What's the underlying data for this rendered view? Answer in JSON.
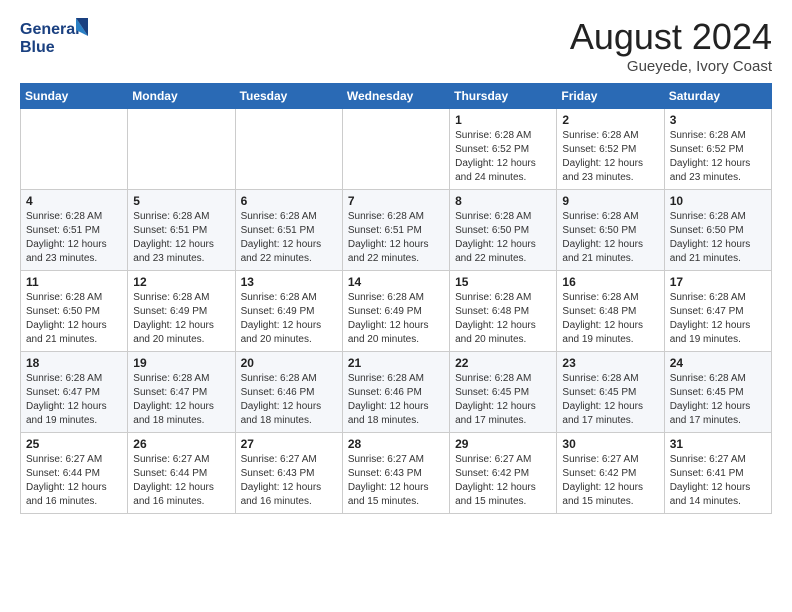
{
  "logo": {
    "line1": "General",
    "line2": "Blue"
  },
  "header": {
    "month": "August 2024",
    "location": "Gueyede, Ivory Coast"
  },
  "weekdays": [
    "Sunday",
    "Monday",
    "Tuesday",
    "Wednesday",
    "Thursday",
    "Friday",
    "Saturday"
  ],
  "weeks": [
    [
      {
        "day": "",
        "info": ""
      },
      {
        "day": "",
        "info": ""
      },
      {
        "day": "",
        "info": ""
      },
      {
        "day": "",
        "info": ""
      },
      {
        "day": "1",
        "info": "Sunrise: 6:28 AM\nSunset: 6:52 PM\nDaylight: 12 hours\nand 24 minutes."
      },
      {
        "day": "2",
        "info": "Sunrise: 6:28 AM\nSunset: 6:52 PM\nDaylight: 12 hours\nand 23 minutes."
      },
      {
        "day": "3",
        "info": "Sunrise: 6:28 AM\nSunset: 6:52 PM\nDaylight: 12 hours\nand 23 minutes."
      }
    ],
    [
      {
        "day": "4",
        "info": "Sunrise: 6:28 AM\nSunset: 6:51 PM\nDaylight: 12 hours\nand 23 minutes."
      },
      {
        "day": "5",
        "info": "Sunrise: 6:28 AM\nSunset: 6:51 PM\nDaylight: 12 hours\nand 23 minutes."
      },
      {
        "day": "6",
        "info": "Sunrise: 6:28 AM\nSunset: 6:51 PM\nDaylight: 12 hours\nand 22 minutes."
      },
      {
        "day": "7",
        "info": "Sunrise: 6:28 AM\nSunset: 6:51 PM\nDaylight: 12 hours\nand 22 minutes."
      },
      {
        "day": "8",
        "info": "Sunrise: 6:28 AM\nSunset: 6:50 PM\nDaylight: 12 hours\nand 22 minutes."
      },
      {
        "day": "9",
        "info": "Sunrise: 6:28 AM\nSunset: 6:50 PM\nDaylight: 12 hours\nand 21 minutes."
      },
      {
        "day": "10",
        "info": "Sunrise: 6:28 AM\nSunset: 6:50 PM\nDaylight: 12 hours\nand 21 minutes."
      }
    ],
    [
      {
        "day": "11",
        "info": "Sunrise: 6:28 AM\nSunset: 6:50 PM\nDaylight: 12 hours\nand 21 minutes."
      },
      {
        "day": "12",
        "info": "Sunrise: 6:28 AM\nSunset: 6:49 PM\nDaylight: 12 hours\nand 20 minutes."
      },
      {
        "day": "13",
        "info": "Sunrise: 6:28 AM\nSunset: 6:49 PM\nDaylight: 12 hours\nand 20 minutes."
      },
      {
        "day": "14",
        "info": "Sunrise: 6:28 AM\nSunset: 6:49 PM\nDaylight: 12 hours\nand 20 minutes."
      },
      {
        "day": "15",
        "info": "Sunrise: 6:28 AM\nSunset: 6:48 PM\nDaylight: 12 hours\nand 20 minutes."
      },
      {
        "day": "16",
        "info": "Sunrise: 6:28 AM\nSunset: 6:48 PM\nDaylight: 12 hours\nand 19 minutes."
      },
      {
        "day": "17",
        "info": "Sunrise: 6:28 AM\nSunset: 6:47 PM\nDaylight: 12 hours\nand 19 minutes."
      }
    ],
    [
      {
        "day": "18",
        "info": "Sunrise: 6:28 AM\nSunset: 6:47 PM\nDaylight: 12 hours\nand 19 minutes."
      },
      {
        "day": "19",
        "info": "Sunrise: 6:28 AM\nSunset: 6:47 PM\nDaylight: 12 hours\nand 18 minutes."
      },
      {
        "day": "20",
        "info": "Sunrise: 6:28 AM\nSunset: 6:46 PM\nDaylight: 12 hours\nand 18 minutes."
      },
      {
        "day": "21",
        "info": "Sunrise: 6:28 AM\nSunset: 6:46 PM\nDaylight: 12 hours\nand 18 minutes."
      },
      {
        "day": "22",
        "info": "Sunrise: 6:28 AM\nSunset: 6:45 PM\nDaylight: 12 hours\nand 17 minutes."
      },
      {
        "day": "23",
        "info": "Sunrise: 6:28 AM\nSunset: 6:45 PM\nDaylight: 12 hours\nand 17 minutes."
      },
      {
        "day": "24",
        "info": "Sunrise: 6:28 AM\nSunset: 6:45 PM\nDaylight: 12 hours\nand 17 minutes."
      }
    ],
    [
      {
        "day": "25",
        "info": "Sunrise: 6:27 AM\nSunset: 6:44 PM\nDaylight: 12 hours\nand 16 minutes."
      },
      {
        "day": "26",
        "info": "Sunrise: 6:27 AM\nSunset: 6:44 PM\nDaylight: 12 hours\nand 16 minutes."
      },
      {
        "day": "27",
        "info": "Sunrise: 6:27 AM\nSunset: 6:43 PM\nDaylight: 12 hours\nand 16 minutes."
      },
      {
        "day": "28",
        "info": "Sunrise: 6:27 AM\nSunset: 6:43 PM\nDaylight: 12 hours\nand 15 minutes."
      },
      {
        "day": "29",
        "info": "Sunrise: 6:27 AM\nSunset: 6:42 PM\nDaylight: 12 hours\nand 15 minutes."
      },
      {
        "day": "30",
        "info": "Sunrise: 6:27 AM\nSunset: 6:42 PM\nDaylight: 12 hours\nand 15 minutes."
      },
      {
        "day": "31",
        "info": "Sunrise: 6:27 AM\nSunset: 6:41 PM\nDaylight: 12 hours\nand 14 minutes."
      }
    ]
  ]
}
